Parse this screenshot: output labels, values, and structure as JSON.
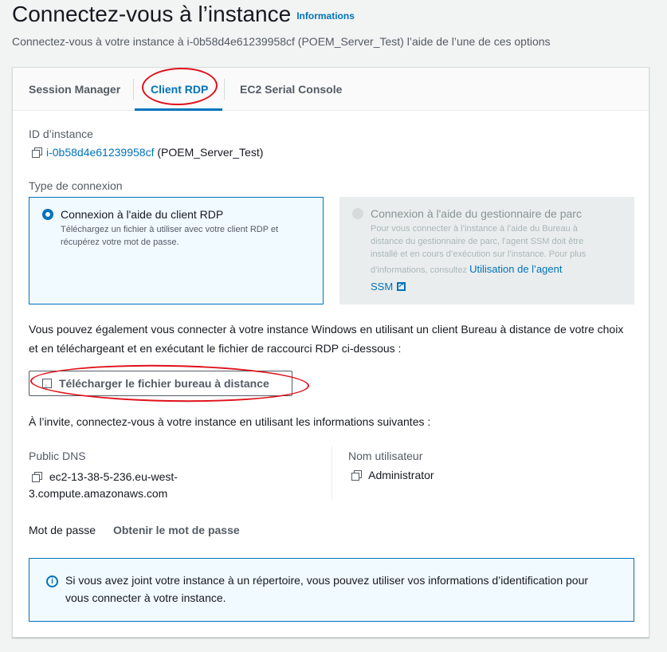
{
  "header": {
    "title": "Connectez-vous à l’instance",
    "info_link": "Informations",
    "subtitle": "Connectez-vous à votre instance à i-0b58d4e61239958cf (POEM_Server_Test) l’aide de l’une de ces options"
  },
  "tabs": [
    {
      "label": "Session Manager"
    },
    {
      "label": "Client RDP",
      "active": true
    },
    {
      "label": "EC2 Serial Console"
    }
  ],
  "instance": {
    "label": "ID d’instance",
    "id": "i-0b58d4e61239958cf",
    "name": "(POEM_Server_Test)"
  },
  "connection_type": {
    "label": "Type de connexion",
    "options": [
      {
        "title": "Connexion à l'aide du client RDP",
        "desc_line1": "Téléchargez un fichier à utiliser avec votre client RDP et",
        "desc_line2": "récupérez votre mot de passe.",
        "selected": true
      },
      {
        "title": "Connexion à l'aide du gestionnaire de parc",
        "desc_line1": "Pour vous connecter à l’instance à l’aide du Bureau à",
        "desc_line2": "distance du gestionnaire de parc, l’agent SSM doit être",
        "desc_line3": "installé et en cours d’exécution sur l’instance. Pour plus",
        "desc_line4": "d’informations, consultez",
        "link_line1": "Utilisation de l’agent",
        "link_line2": "SSM",
        "disabled": true
      }
    ]
  },
  "rdp": {
    "intro_line1": "Vous pouvez également vous connecter à votre instance Windows en utilisant un client Bureau à distance de votre choix",
    "intro_line2": "et en téléchargeant et en exécutant le fichier de raccourci RDP ci-dessous :",
    "download_button": "Télécharger le fichier bureau à distance",
    "prompt": "À l’invite, connectez-vous à votre instance en utilisant les informations suivantes :",
    "public_dns_label": "Public DNS",
    "public_dns_line1": "ec2-13-38-5-236.eu-west-",
    "public_dns_line2": "3.compute.amazonaws.com",
    "username_label": "Nom utilisateur",
    "username": "Administrator",
    "password_label": "Mot de passe",
    "password_action": "Obtenir le mot de passe"
  },
  "alert": {
    "line1": "Si vous avez joint votre instance à un répertoire, vous pouvez utiliser vos informations d’identification pour",
    "line2": "vous connecter à votre instance."
  },
  "colors": {
    "accent": "#0073bb",
    "annotation": "#e0101a",
    "background": "#f2f3f3"
  }
}
